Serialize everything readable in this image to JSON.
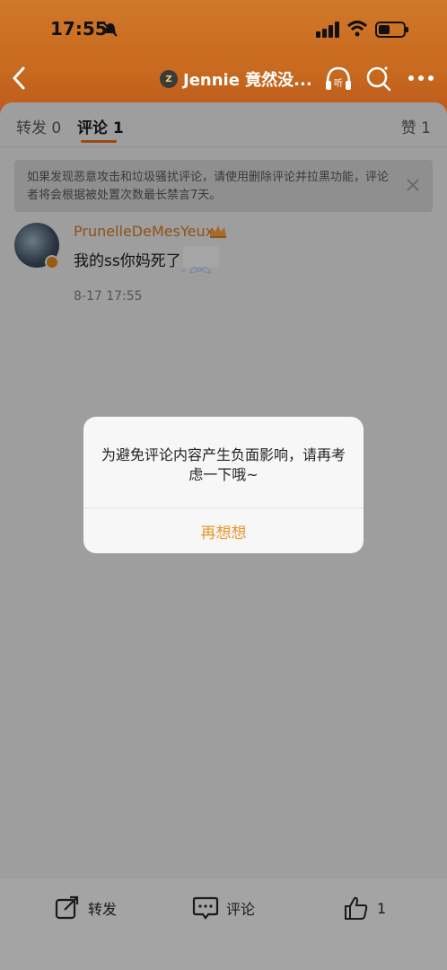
{
  "status_bar": {
    "time": "17:55"
  },
  "nav": {
    "badge": "Z",
    "title": "Jennie 竟然没..."
  },
  "tabs": {
    "repost": "转发 0",
    "comment": "评论 1",
    "like": "赞 1"
  },
  "notice": {
    "text": "如果发现恶意攻击和垃圾骚扰评论，请使用删除评论并拉黑功能，评论者将会根据被处置次数最长禁言7天。"
  },
  "comment": {
    "username": "PrunelleDeMesYeux",
    "text": "我的ss你妈死了",
    "time": "8-17 17:55"
  },
  "dialog": {
    "message": "为避免评论内容产生负面影响，请再考虑一下哦~",
    "button": "再想想"
  },
  "bottom_bar": {
    "repost": "转发",
    "comment": "评论",
    "like": "1"
  },
  "colors": {
    "header": "#c86a1f",
    "accent": "#e8952a",
    "dim_overlay": "#9e9e9e"
  }
}
